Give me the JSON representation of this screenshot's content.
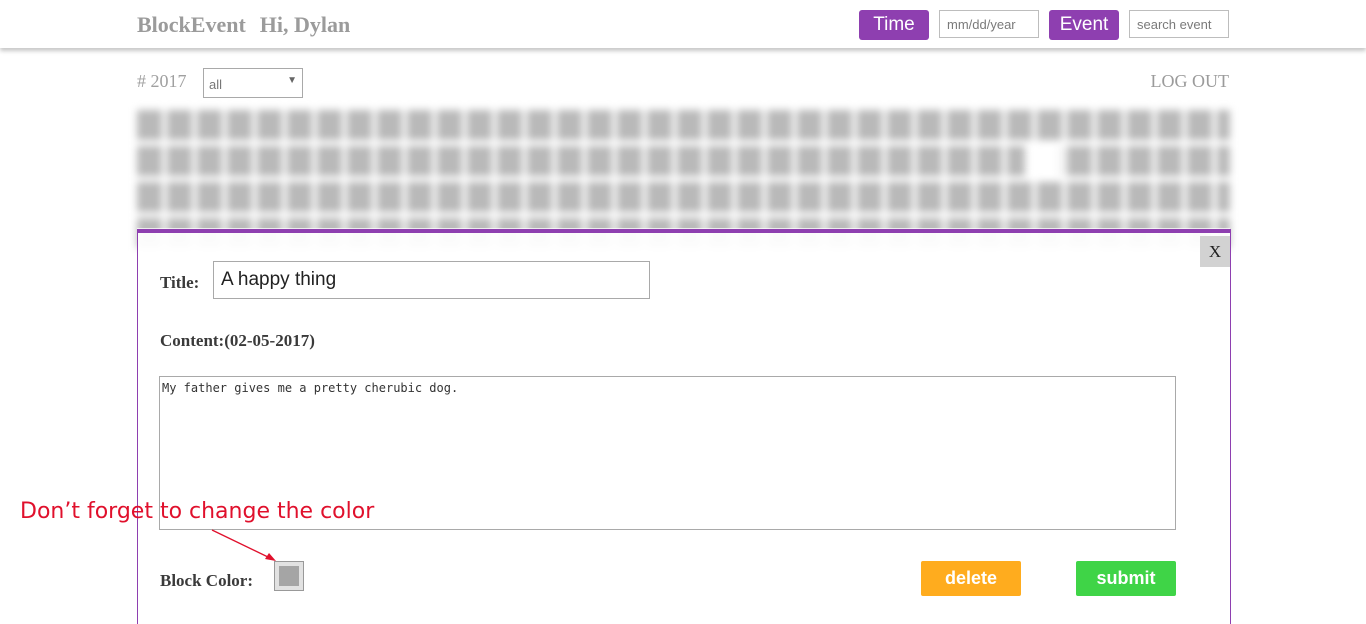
{
  "header": {
    "brand": "BlockEvent",
    "greeting": "Hi, Dylan",
    "time_button": "Time",
    "date_placeholder": "mm/dd/year",
    "event_button": "Event",
    "search_placeholder": "search event"
  },
  "toolbar": {
    "year": "# 2017",
    "filter_value": "all",
    "logout": "LOG OUT"
  },
  "modal": {
    "close": "X",
    "title_label": "Title:",
    "title_value": "A happy thing",
    "content_label": "Content:(02-05-2017)",
    "content_value": "My father gives me a pretty cherubic dog.",
    "block_color_label": "Block Color:",
    "block_color": "#a5a5a5",
    "delete_button": "delete",
    "submit_button": "submit"
  },
  "colors": {
    "accent": "#8e3fb0",
    "delete": "#ffac1e",
    "submit": "#3fd447",
    "annotation": "#e0102c"
  },
  "annotation": {
    "text": "Don’t forget to change the color"
  }
}
